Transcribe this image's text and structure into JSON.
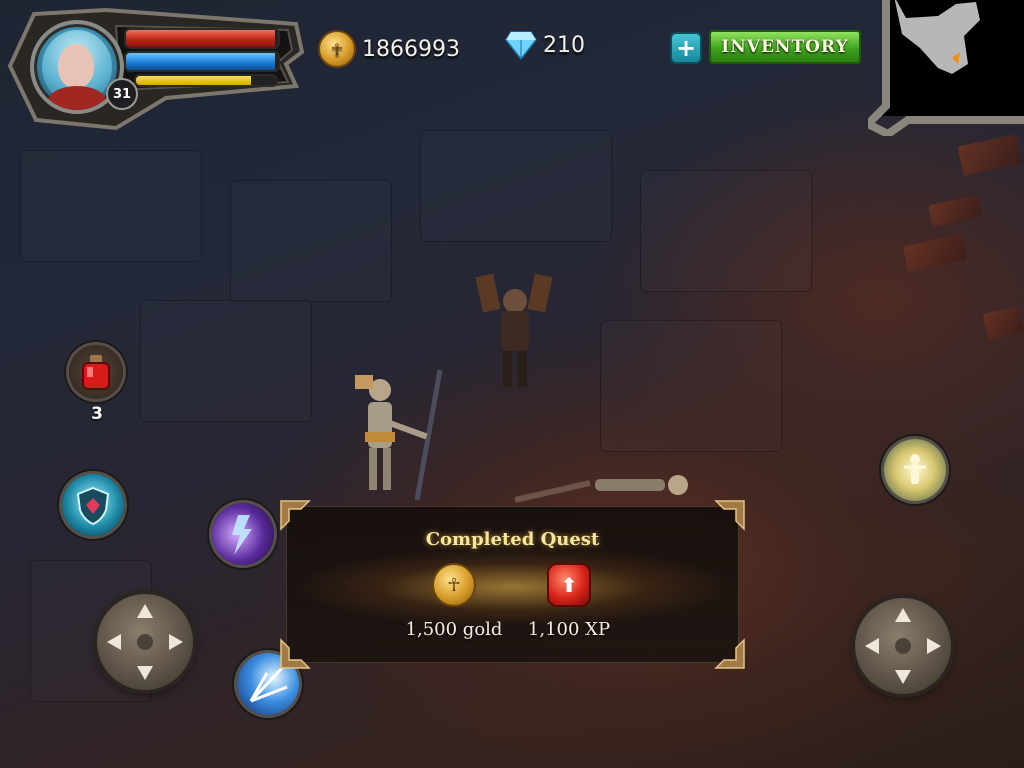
{
  "player": {
    "level": "31",
    "health_fraction": 0.98,
    "mana_fraction": 0.98,
    "xp_fraction": 0.82
  },
  "currency": {
    "gold": "1866993",
    "gems": "210"
  },
  "toolbar": {
    "add_label": "+",
    "inventory_label": "INVENTORY"
  },
  "potions": {
    "count": "3"
  },
  "quest_popup": {
    "title": "Completed Quest",
    "gold_reward": "1,500 gold",
    "xp_reward": "1,100 XP"
  },
  "colors": {
    "health": "#c02418",
    "mana": "#1c7ed8",
    "xp": "#d7a90d",
    "inventory_button": "#3fa41d",
    "add_button": "#15879a",
    "quest_title": "#f8e79a"
  },
  "icons": {
    "gold": "gold-coin-icon",
    "gem": "diamond-icon",
    "potion": "red-potion-icon",
    "xp": "level-up-arrow-icon"
  }
}
